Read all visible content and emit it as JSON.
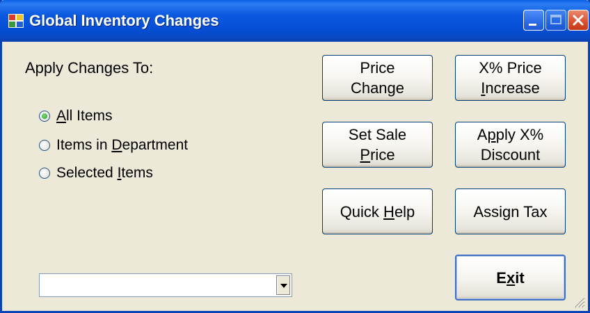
{
  "window": {
    "title": "Global Inventory Changes"
  },
  "apply_label": "Apply Changes To:",
  "scope_options": [
    {
      "before": "",
      "mnemonic": "A",
      "after": "ll Items",
      "checked": true
    },
    {
      "before": "Items in ",
      "mnemonic": "D",
      "after": "epartment",
      "checked": false
    },
    {
      "before": "Selected ",
      "mnemonic": "I",
      "after": "tems",
      "checked": false
    }
  ],
  "buttons": {
    "price_change": {
      "line1": "Price",
      "line2": "Change"
    },
    "price_increase": {
      "line1": "X% Price",
      "line2_mn": "I",
      "line2_rest": "ncrease"
    },
    "set_sale_price": {
      "line1": "Set Sale",
      "line2_mn": "P",
      "line2_rest": "rice"
    },
    "apply_discount": {
      "line1_a": "A",
      "line1_mn": "p",
      "line1_b": "ply X%",
      "line2": "Discount"
    },
    "quick_help": {
      "before": "Quick ",
      "mn": "H",
      "after": "elp"
    },
    "assign_tax": {
      "label": "Assign Tax"
    },
    "exit": {
      "before": "E",
      "mn": "x",
      "after": "it"
    }
  },
  "dropdown": {
    "value": ""
  },
  "colors": {
    "titlebar": "#0a5fe6",
    "window_bg": "#ece9d8",
    "radio_checked": "#21a121"
  },
  "icons": {
    "app": "app-icon",
    "minimize": "minimize-icon",
    "maximize": "maximize-icon",
    "close": "close-icon",
    "dropdown": "chevron-down-icon",
    "resize": "resize-grip-icon"
  }
}
